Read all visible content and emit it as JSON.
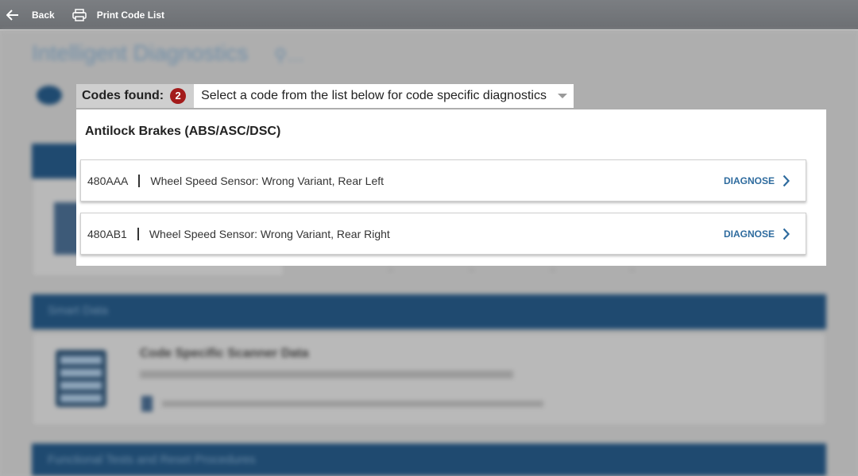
{
  "toolbar": {
    "back_label": "Back",
    "print_label": "Print Code List"
  },
  "header": {
    "page_title": "Intelligent Diagnostics",
    "codes_found_label": "Codes found:",
    "codes_count": "2",
    "select_text": "Select a code from the list below for code specific diagnostics"
  },
  "dropdown": {
    "group_title": "Antilock Brakes (ABS/ASC/DSC)",
    "codes": [
      {
        "id": "480AAA",
        "description": "Wheel Speed Sensor: Wrong Variant, Rear Left",
        "action": "DIAGNOSE"
      },
      {
        "id": "480AB1",
        "description": "Wheel Speed Sensor: Wrong Variant, Rear Right",
        "action": "DIAGNOSE"
      }
    ]
  },
  "background": {
    "smart_data_bar": "Smart Data",
    "scanner_heading": "Code Specific Scanner Data",
    "functional_bar": "Functional Tests and Reset Procedures"
  },
  "colors": {
    "topbar": "#74777b",
    "badge": "#a31b1b",
    "diagnose_link": "#2e6b9e",
    "section_bar": "#1f4a70"
  }
}
